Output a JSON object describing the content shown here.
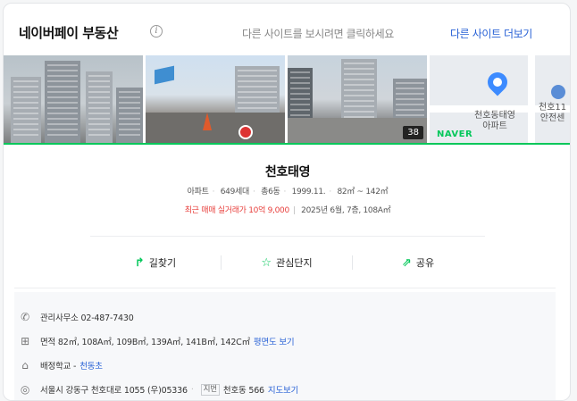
{
  "header": {
    "brand": "네이버페이 부동산",
    "info_symbol": "i",
    "hint": "다른 사이트를 보시려면 클릭하세요",
    "more_link": "다른 사이트 더보기"
  },
  "photos": {
    "count": "38",
    "map_labels": {
      "pin_label": "천호동태영\n아파트",
      "side_label": "천호11\n안전센"
    },
    "map_brand": "NAVER"
  },
  "listing": {
    "name": "천호태영",
    "type": "아파트",
    "households": "649세대",
    "buildings": "총6동",
    "built": "1999.11.",
    "area_range": "82㎡ ~ 142㎡",
    "recent_trade": "최근 매매 실거래가 10억 9,000",
    "trade_detail": "2025년 6월, 7층, 108A㎡"
  },
  "actions": [
    {
      "label": "길찾기",
      "icon": "route-icon"
    },
    {
      "label": "관심단지",
      "icon": "star-icon"
    },
    {
      "label": "공유",
      "icon": "share-icon"
    }
  ],
  "info": {
    "office": "관리사무소 02-487-7430",
    "area": "면적 82㎡, 108A㎡, 109B㎡, 139A㎡, 141B㎡, 142C㎡",
    "floorplan_link": "평면도 보기",
    "school_prefix": "배정학교 -",
    "school_link": "천동초",
    "address": "서울시 강동구 천호대로 1055 (우)05336",
    "jibun_tag": "지번",
    "jibun": "천호동 566",
    "map_link": "지도보기"
  },
  "colors": {
    "accent_green": "#03c75a",
    "link_blue": "#2962d6",
    "price_red": "#e8403d"
  }
}
